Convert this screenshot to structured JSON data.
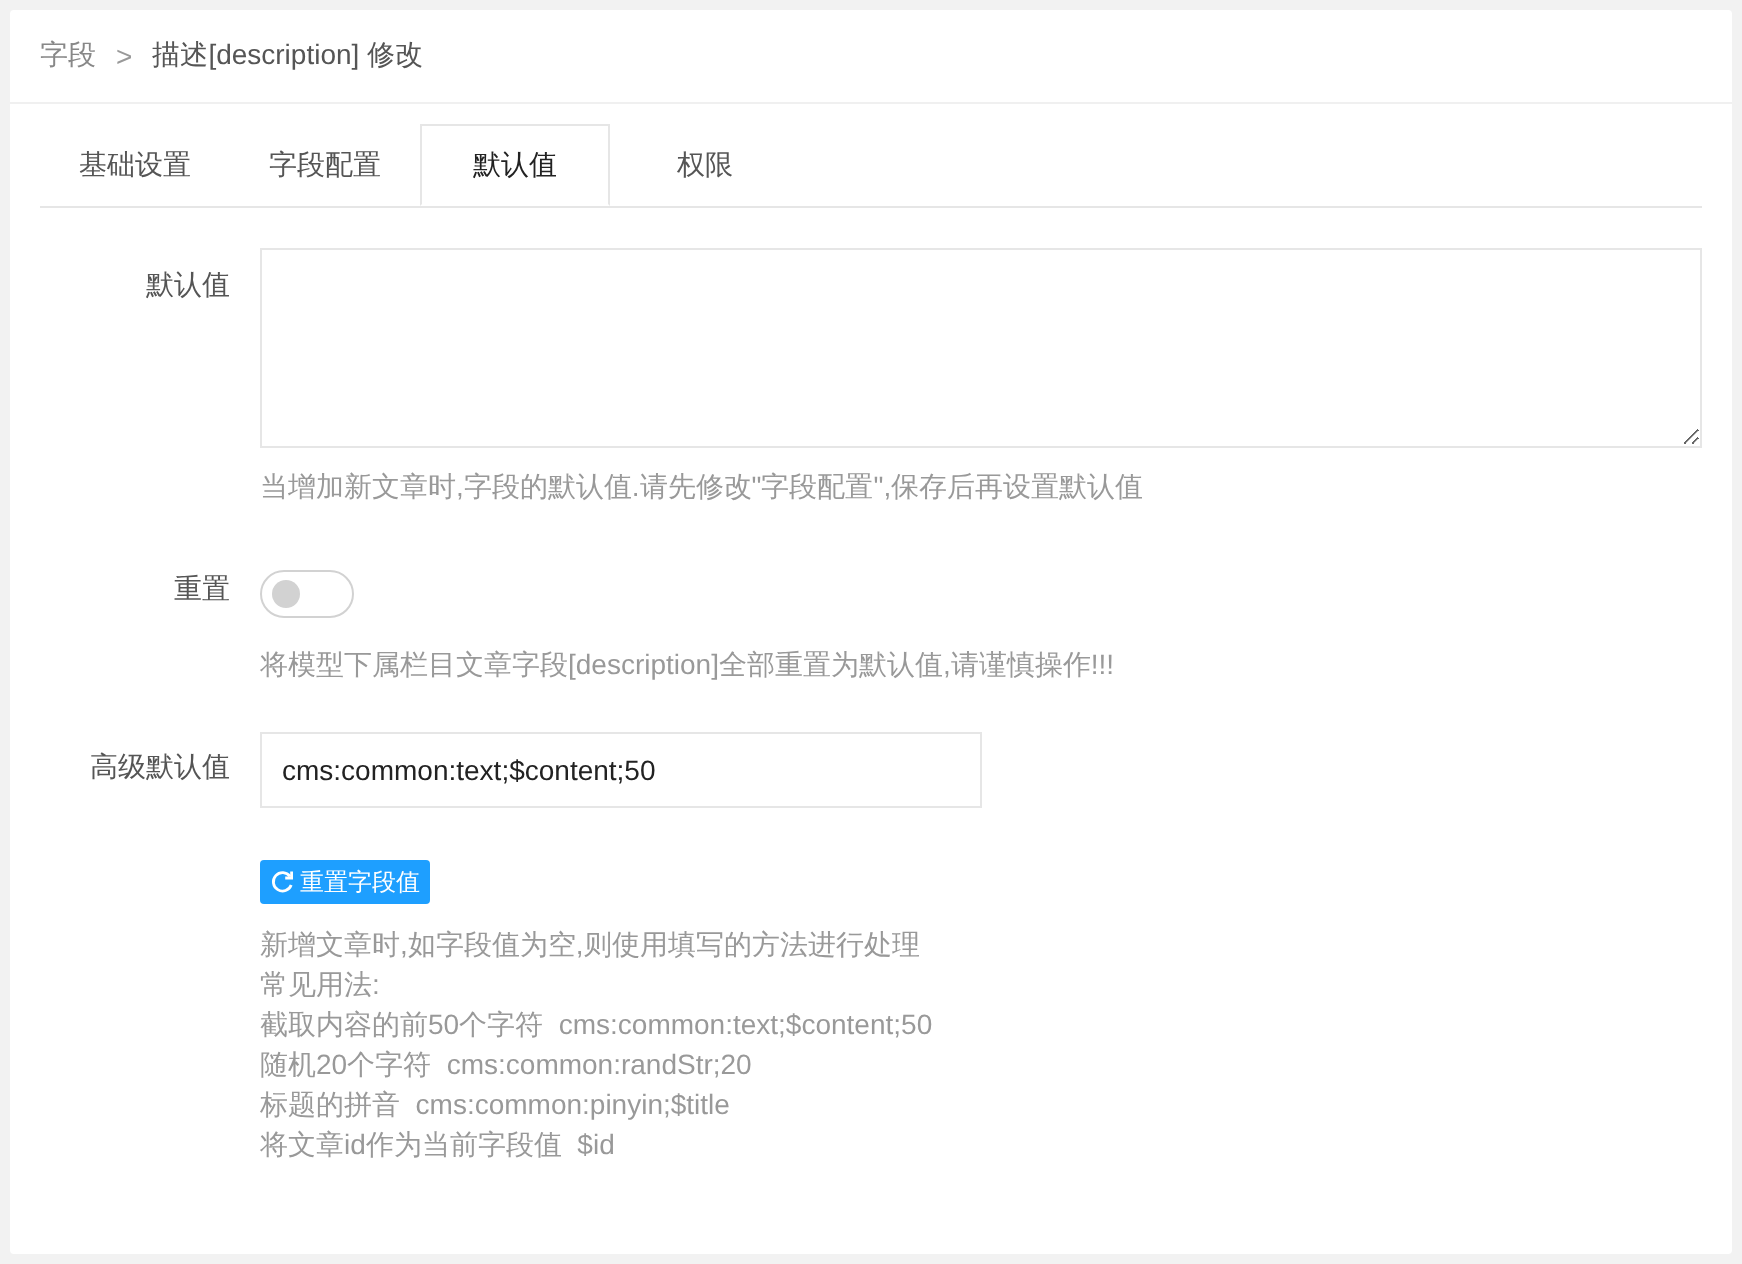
{
  "breadcrumb": {
    "parent": "字段",
    "separator": ">",
    "current": "描述[description] 修改"
  },
  "tabs": [
    {
      "label": "基础设置",
      "selected": false
    },
    {
      "label": "字段配置",
      "selected": false
    },
    {
      "label": "默认值",
      "selected": true
    },
    {
      "label": "权限",
      "selected": false
    }
  ],
  "form": {
    "default_value": {
      "label": "默认值",
      "help": "当增加新文章时,字段的默认值.请先修改\"字段配置\",保存后再设置默认值"
    },
    "reset": {
      "label": "重置",
      "on": false,
      "help": "将模型下属栏目文章字段[description]全部重置为默认值,请谨慎操作!!!"
    },
    "advanced_default": {
      "label": "高级默认值",
      "value": "cms:common:text;$content;50",
      "button": "重置字段值",
      "help_lines": [
        "新增文章时,如字段值为空,则使用填写的方法进行处理",
        "常见用法:",
        "截取内容的前50个字符  cms:common:text;$content;50",
        "随机20个字符  cms:common:randStr;20",
        "标题的拼音  cms:common:pinyin;$title",
        "将文章id作为当前字段值  $id"
      ]
    }
  }
}
